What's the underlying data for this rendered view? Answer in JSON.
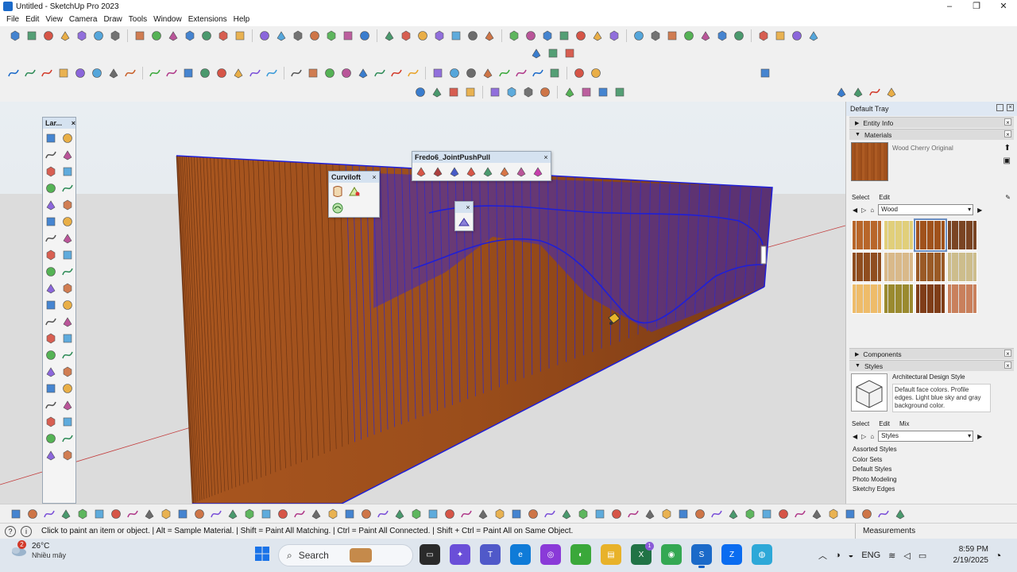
{
  "window": {
    "title": "Untitled - SketchUp Pro 2023",
    "minimize": "–",
    "maximize": "❐",
    "close": "✕"
  },
  "menu": [
    "File",
    "Edit",
    "View",
    "Camera",
    "Draw",
    "Tools",
    "Window",
    "Extensions",
    "Help"
  ],
  "floating": {
    "large_toolset_title": "Lar...",
    "curviloft_title": "Curviloft",
    "joint_pushpull_title": "Fredo6_JointPushPull",
    "close": "×"
  },
  "tray": {
    "title": "Default Tray",
    "entity_info": "Entity Info",
    "materials": "Materials",
    "material_name": "Wood Cherry Original",
    "mat_tab_select": "Select",
    "mat_tab_edit": "Edit",
    "mat_library": "Wood",
    "components": "Components",
    "styles": "Styles",
    "style_name": "Architectural Design Style",
    "style_description": "Default face colors. Profile edges. Light blue sky and gray background color.",
    "style_tab_select": "Select",
    "style_tab_edit": "Edit",
    "style_tab_mix": "Mix",
    "style_library": "Styles",
    "style_list": [
      "Assorted Styles",
      "Color Sets",
      "Default Styles",
      "Photo Modeling",
      "Sketchy Edges"
    ],
    "swatch_colors": [
      "#b8662a",
      "#e1cf7a",
      "#a0521c",
      "#7a4423",
      "#8f4d1f",
      "#d9b98a",
      "#9a5a26",
      "#cdbd8c",
      "#eebc6a",
      "#9a8a2f",
      "#7f3d18",
      "#c9805c"
    ]
  },
  "status": {
    "hint": "Click to paint an item or object. | Alt = Sample Material. | Shift = Paint All Matching. | Ctrl = Paint All Connected. | Shift + Ctrl = Paint All on Same Object.",
    "measurements_label": "Measurements"
  },
  "taskbar": {
    "weather_temp": "26°C",
    "weather_desc": "Nhiều mây",
    "weather_badge": "2",
    "search_label": "Search",
    "lang": "ENG",
    "time": "8:59 PM",
    "date": "2/19/2025",
    "teams_badge": "1"
  },
  "colors": {
    "wood": "#a0521d",
    "edge_blue": "#1f1fd8",
    "accent": "#0a5fc6"
  }
}
